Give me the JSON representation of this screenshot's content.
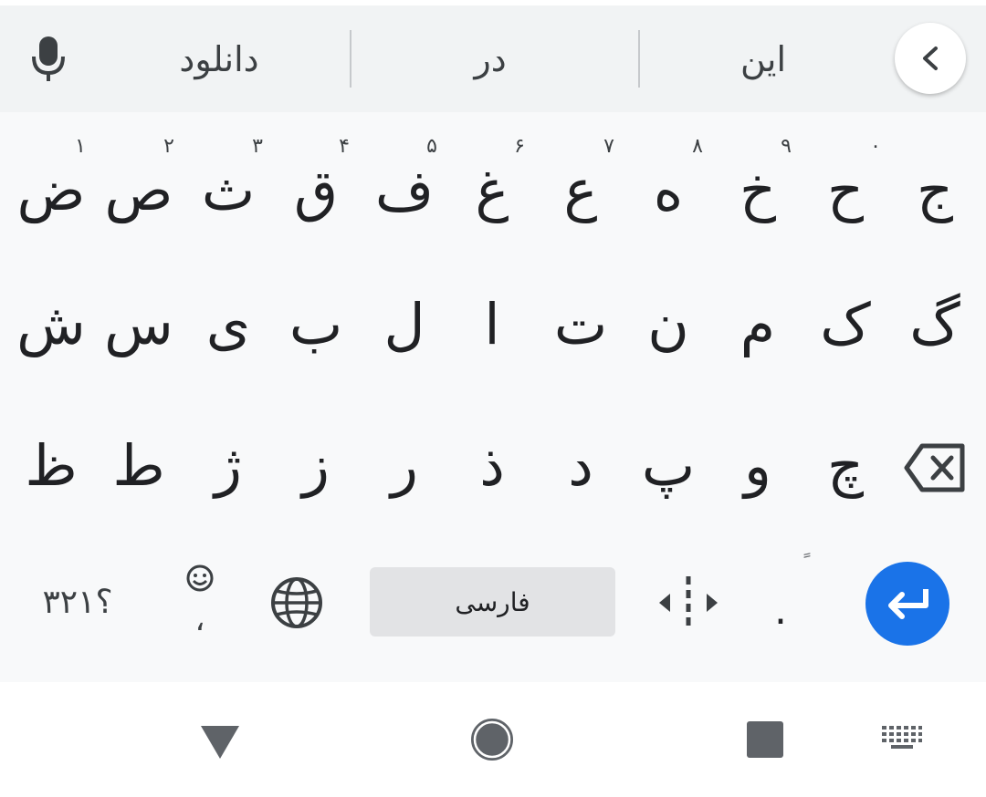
{
  "suggestions": {
    "mic_icon": "mic-icon",
    "items": [
      "دانلود",
      "در",
      "این"
    ],
    "collapse_icon": "chevron-left-icon"
  },
  "keyboard": {
    "row1": {
      "keys": [
        "ض",
        "ص",
        "ث",
        "ق",
        "ف",
        "غ",
        "ع",
        "ه",
        "خ",
        "ح",
        "ج"
      ],
      "hints": [
        "۱",
        "۲",
        "۳",
        "۴",
        "۵",
        "۶",
        "۷",
        "۸",
        "۹",
        "۰",
        ""
      ]
    },
    "row2": {
      "keys": [
        "ش",
        "س",
        "ی",
        "ب",
        "ل",
        "ا",
        "ت",
        "ن",
        "م",
        "ک",
        "گ"
      ]
    },
    "row3": {
      "keys": [
        "ظ",
        "ط",
        "ژ",
        "ز",
        "ر",
        "ذ",
        "د",
        "پ",
        "و",
        "چ"
      ],
      "backspace_icon": "backspace-icon"
    },
    "bottom": {
      "symbols_label": "؟۳۲۱",
      "emoji_comma_label": "،",
      "emoji_icon": "smiley-icon",
      "globe_icon": "globe-icon",
      "space_label": "فارسی",
      "cursor_icon": "cursor-move-icon",
      "period_label": ".",
      "period_hint": "ً",
      "enter_icon": "enter-icon"
    }
  },
  "navbar": {
    "back_icon": "back-triangle-icon",
    "home_icon": "home-circle-icon",
    "recents_icon": "recents-square-icon",
    "keyboard_icon": "keyboard-icon"
  },
  "colors": {
    "accent": "#1a73e8",
    "suggestion_bg": "#f1f3f4",
    "keyboard_bg": "#f8f9fa",
    "space_bg": "#e2e3e5"
  }
}
